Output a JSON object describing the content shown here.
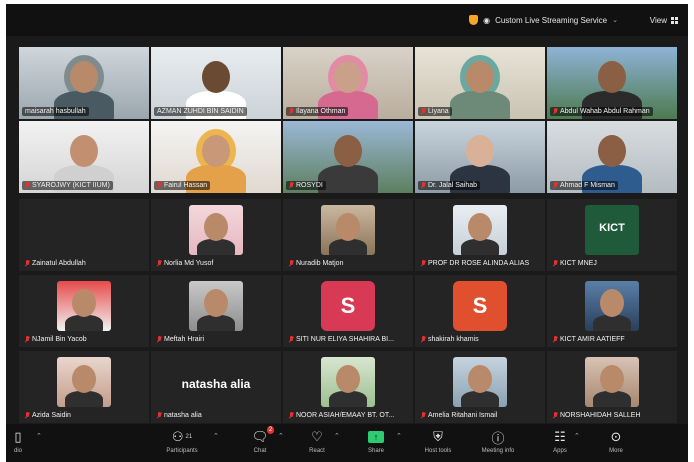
{
  "topbar": {
    "stream_label": "Custom Live Streaming Service",
    "view_label": "View"
  },
  "participants": [
    {
      "name": "maisarah hasbullah",
      "muted": false
    },
    {
      "name": "AZMAN ZUHDI BIN SAIDIN",
      "muted": false,
      "active": true
    },
    {
      "name": "Ilayana Othman",
      "muted": true
    },
    {
      "name": "Liyana",
      "muted": true
    },
    {
      "name": "Abdul Wahab Abdul Rahman",
      "muted": true
    },
    {
      "name": "SYAROJWY (KICT IIUM)",
      "muted": true
    },
    {
      "name": "Fairul Hassan",
      "muted": true
    },
    {
      "name": "ROSYDI",
      "muted": true
    },
    {
      "name": "Dr. Jalal Saihab",
      "muted": true
    },
    {
      "name": "Ahmad F Misman",
      "muted": true
    },
    {
      "name": "Zainatul Abdullah",
      "muted": true
    },
    {
      "name": "Norlia Md Yusof",
      "muted": true
    },
    {
      "name": "Nuradib Matjon",
      "muted": true
    },
    {
      "name": "PROF DR ROSE ALINDA ALIAS",
      "muted": true
    },
    {
      "name": "KICT MNEJ",
      "muted": true,
      "avatar_text": "KICT"
    },
    {
      "name": "NJamil Bin Yacob",
      "muted": true
    },
    {
      "name": "Meftah Hrairi",
      "muted": true
    },
    {
      "name": "SITI NUR ELIYA SHAHIRA BI...",
      "muted": true,
      "letter": "S"
    },
    {
      "name": "shakirah khamis",
      "muted": true,
      "letter": "S"
    },
    {
      "name": "KICT AMIR AATIEFF",
      "muted": true
    },
    {
      "name": "Azida Saidin",
      "muted": true
    },
    {
      "name": "natasha alia",
      "muted": true,
      "name_avatar": "natasha alia"
    },
    {
      "name": "NOOR ASIAH/EMAAY BT. OT...",
      "muted": true
    },
    {
      "name": "Amelia Ritahani Ismail",
      "muted": true
    },
    {
      "name": "NORSHAHIDAH SALLEH",
      "muted": true
    }
  ],
  "toolbar": {
    "audio_label": "dio",
    "participants_label": "Participants",
    "participants_count": "21",
    "chat_label": "Chat",
    "chat_badge": "2",
    "react_label": "React",
    "share_label": "Share",
    "host_tools_label": "Host tools",
    "meeting_info_label": "Meeting info",
    "apps_label": "Apps",
    "more_label": "More"
  },
  "colors": {
    "active_border": "#3ddc84",
    "muted_icon": "#e5322d",
    "share_green": "#2ecc71",
    "letter_avatar": "#d83a56",
    "letter_avatar_2": "#e0502f"
  }
}
